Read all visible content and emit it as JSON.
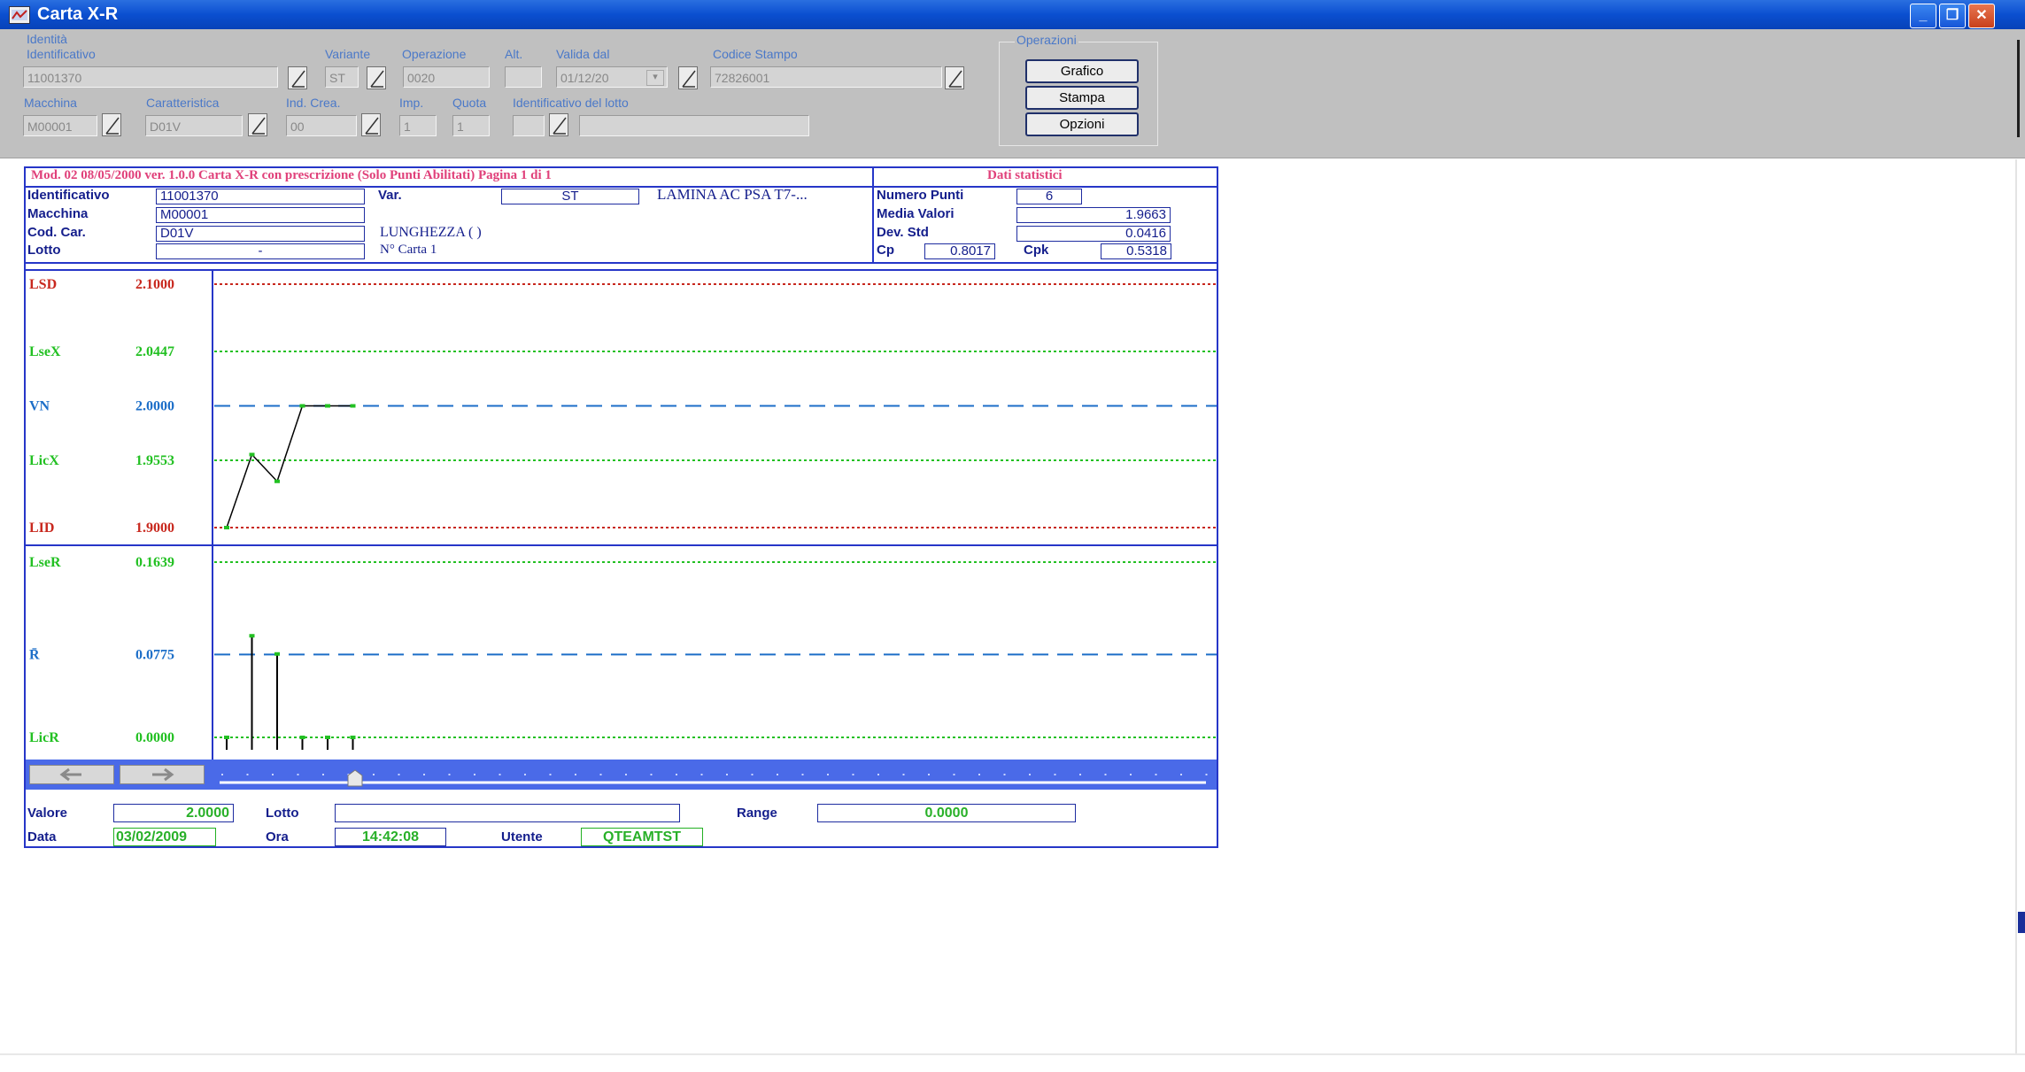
{
  "window": {
    "title": "Carta X-R",
    "minimize": "_",
    "restore": "❐",
    "close": "✕"
  },
  "identita": {
    "group_label": "Identità",
    "identificativo": {
      "label": "Identificativo",
      "value": "11001370"
    },
    "variante": {
      "label": "Variante",
      "value": "ST"
    },
    "operazione": {
      "label": "Operazione",
      "value": "0020"
    },
    "alt": {
      "label": "Alt.",
      "value": ""
    },
    "valida_dal": {
      "label": "Valida dal",
      "value": "01/12/20"
    },
    "codice_stampo": {
      "label": "Codice Stampo",
      "value": "72826001"
    },
    "macchina": {
      "label": "Macchina",
      "value": "M00001"
    },
    "caratteristica": {
      "label": "Caratteristica",
      "value": "D01V"
    },
    "ind_crea": {
      "label": "Ind. Crea.",
      "value": "00"
    },
    "imp": {
      "label": "Imp.",
      "value": "1"
    },
    "quota": {
      "label": "Quota",
      "value": "1"
    },
    "identificativo_lotto": {
      "label": "Identificativo del lotto",
      "value": "",
      "value2": ""
    }
  },
  "operazioni": {
    "group_label": "Operazioni",
    "grafico": "Grafico",
    "stampa": "Stampa",
    "opzioni": "Opzioni"
  },
  "report": {
    "header": "Mod. 02  08/05/2000 ver. 1.0.0 Carta X-R con prescrizione (Solo Punti Abilitati) Pagina    1  di 1",
    "stats_title": "Dati statistici",
    "identificativo_label": "Identificativo",
    "identificativo": "11001370",
    "var_label": "Var.",
    "var": "ST",
    "descrizione": "LAMINA AC PSA T7-...",
    "macchina_label": "Macchina",
    "macchina": "M00001",
    "cod_car_label": "Cod. Car.",
    "cod_car": "D01V",
    "caratteristica": "LUNGHEZZA ( )",
    "lotto_label": "Lotto",
    "lotto": "-",
    "n_carta": "N° Carta 1",
    "numero_punti_label": "Numero Punti",
    "numero_punti": "6",
    "media_label": "Media Valori",
    "media": "1.9663",
    "devstd_label": "Dev. Std",
    "devstd": "0.0416",
    "cp_label": "Cp",
    "cp": "0.8017",
    "cpk_label": "Cpk",
    "cpk": "0.5318"
  },
  "chart_data": [
    {
      "type": "line",
      "limits": [
        {
          "name": "LSD",
          "value": 2.1,
          "label": "2.1000",
          "color": "#c8281e",
          "style": "dotted"
        },
        {
          "name": "LseX",
          "value": 2.0447,
          "label": "2.0447",
          "color": "#22c022",
          "style": "dotted"
        },
        {
          "name": "VN",
          "value": 2.0,
          "label": "2.0000",
          "color": "#1c6ec8",
          "style": "dashed"
        },
        {
          "name": "LicX",
          "value": 1.9553,
          "label": "1.9553",
          "color": "#22c022",
          "style": "dotted"
        },
        {
          "name": "LID",
          "value": 1.9,
          "label": "1.9000",
          "color": "#c8281e",
          "style": "dotted"
        }
      ],
      "x": [
        1,
        2,
        3,
        4,
        5,
        6
      ],
      "values": [
        1.9,
        1.96,
        1.938,
        2.0,
        2.0,
        2.0
      ],
      "ylim": [
        1.9,
        2.1
      ]
    },
    {
      "type": "bar",
      "limits": [
        {
          "name": "LseR",
          "value": 0.1639,
          "label": "0.1639",
          "color": "#22c022",
          "style": "dotted"
        },
        {
          "name": "R̄",
          "value": 0.0775,
          "label": "0.0775",
          "color": "#1c6ec8",
          "style": "dashed"
        },
        {
          "name": "LicR",
          "value": 0.0,
          "label": "0.0000",
          "color": "#22c022",
          "style": "dotted"
        }
      ],
      "x": [
        1,
        2,
        3,
        4,
        5,
        6
      ],
      "values": [
        0.0,
        0.095,
        0.078,
        0.0,
        0.0,
        0.0
      ],
      "ylim": [
        0.0,
        0.1639
      ]
    }
  ],
  "footer": {
    "valore_label": "Valore",
    "valore": "2.0000",
    "lotto_label": "Lotto",
    "lotto": "",
    "range_label": "Range",
    "range": "0.0000",
    "data_label": "Data",
    "data": "03/02/2009",
    "ora_label": "Ora",
    "ora": "14:42:08",
    "utente_label": "Utente",
    "utente": "QTEAMTST"
  },
  "colors": {
    "titlebar": "#0a4fd0",
    "panel": "#c0c0c0",
    "report_border": "#2636c8",
    "header_pink": "#e0407a",
    "slider": "#4a6ae8"
  },
  "icons": [
    "app-icon",
    "lookup-icon",
    "arrow-left-icon",
    "arrow-right-icon",
    "slider-thumb-icon"
  ]
}
